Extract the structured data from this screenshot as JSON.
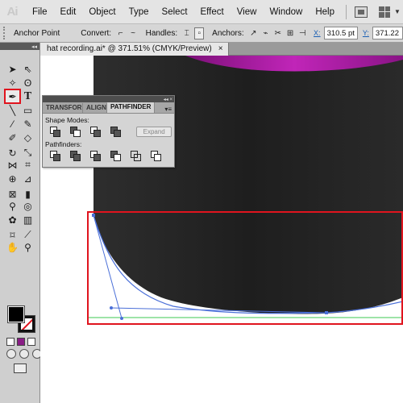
{
  "app": {
    "logo_text": "Ai"
  },
  "menu": {
    "items": [
      "File",
      "Edit",
      "Object",
      "Type",
      "Select",
      "Effect",
      "View",
      "Window",
      "Help"
    ]
  },
  "control_bar": {
    "tool_name": "Anchor Point",
    "convert_label": "Convert:",
    "handles_label": "Handles:",
    "anchors_label": "Anchors:",
    "x_label": "X:",
    "x_value": "310.5 pt",
    "y_label": "Y:",
    "y_value": "371.22"
  },
  "document": {
    "tab_title": "hat recording.ai* @ 371.51% (CMYK/Preview)",
    "close_glyph": "×"
  },
  "pathfinder_panel": {
    "tabs": [
      "TRANSFORM",
      "ALIGN",
      "PATHFINDER"
    ],
    "active_tab": "PATHFINDER",
    "shape_modes_label": "Shape Modes:",
    "expand_label": "Expand",
    "pathfinders_label": "Pathfinders:"
  },
  "colors": {
    "hat_dark": "#262626",
    "hat_brim_highlight": "#b01aa8",
    "selection_box": "#e0141e",
    "path_blue": "#4a6fd8",
    "guide_green": "#3cc850"
  },
  "tools": {
    "selected": "pen-tool",
    "list": [
      "selection-tool",
      "direct-selection-tool",
      "magic-wand-tool",
      "lasso-tool",
      "pen-tool",
      "type-tool",
      "line-segment-tool",
      "rectangle-tool",
      "paintbrush-tool",
      "pencil-tool",
      "blob-brush-tool",
      "eraser-tool",
      "rotate-tool",
      "scale-tool",
      "width-tool",
      "free-transform-tool",
      "shape-builder-tool",
      "perspective-grid-tool",
      "mesh-tool",
      "gradient-tool",
      "eyedropper-tool",
      "blend-tool",
      "symbol-sprayer-tool",
      "column-graph-tool",
      "artboard-tool",
      "slice-tool",
      "hand-tool",
      "zoom-tool"
    ]
  }
}
